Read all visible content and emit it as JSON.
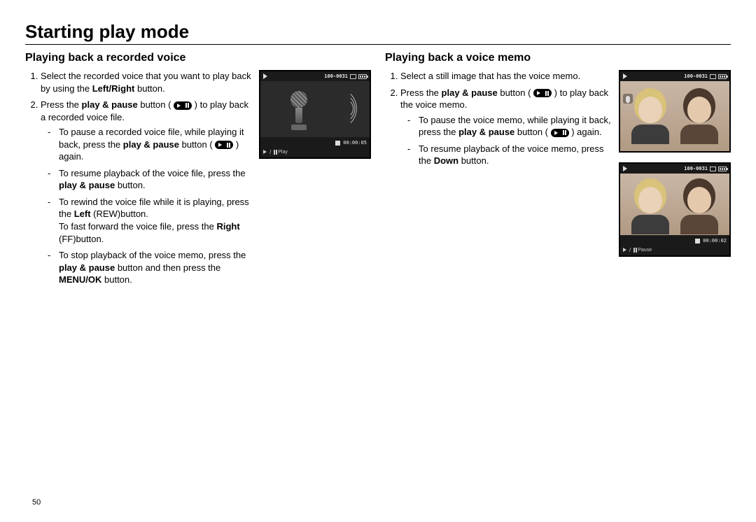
{
  "page_number": "50",
  "title": "Starting play mode",
  "left": {
    "heading": "Playing back a recorded voice",
    "step1_a": "Select the recorded voice that you want to play back by using the ",
    "step1_b1": "Left/Right",
    "step1_c": " button.",
    "step2_a": "Press the ",
    "step2_b1": "play & pause",
    "step2_c": " button ( ",
    "step2_d": " ) to play back a recorded voice file.",
    "d1_a": "To pause a recorded voice file, while playing it back, press the ",
    "d1_b1": "play & pause",
    "d1_c": " button ( ",
    "d1_d": " ) again.",
    "d2_a": "To resume playback of the voice file, press the ",
    "d2_b1": "play & pause",
    "d2_c": " button.",
    "d3_a": "To rewind the voice file while it is playing, press the ",
    "d3_b1": "Left",
    "d3_c": " (REW)button.",
    "d3_d": "To fast forward the voice file, press the ",
    "d3_b2": "Right",
    "d3_e": " (FF)button.",
    "d4_a": "To stop playback of the voice memo, press the ",
    "d4_b1": "play & pause",
    "d4_c": " button and then press the ",
    "d4_b2": "MENU/OK",
    "d4_d": " button.",
    "scr": {
      "file": "100-0031",
      "time": "00:00:05",
      "action": "Play"
    }
  },
  "right": {
    "heading": "Playing back a voice memo",
    "step1": "Select a still image that has the voice memo.",
    "step2_a": "Press the ",
    "step2_b1": "play & pause",
    "step2_c": " button ( ",
    "step2_d": " ) to play back the voice memo.",
    "d1_a": "To pause the voice memo, while playing it back, press the ",
    "d1_b1": "play & pause",
    "d1_c": " button ( ",
    "d1_d": " ) again.",
    "d2_a": "To resume playback of the voice memo, press the ",
    "d2_b1": "Down",
    "d2_c": " button.",
    "scr1": {
      "file": "100-0031"
    },
    "scr2": {
      "file": "100-0031",
      "time": "00:00:02",
      "action": "Pause"
    }
  }
}
